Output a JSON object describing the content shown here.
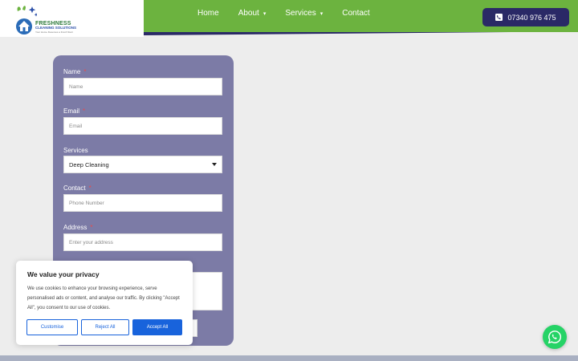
{
  "brand": {
    "title": "FRESHNESS",
    "subtitle": "CLEANING SOLUTIONS",
    "tagline": "Your Home Deserves a Fresh Start",
    "colors": {
      "green": "#6cb33f",
      "navy": "#2a2966",
      "accent_blue": "#1863dc"
    }
  },
  "nav": {
    "items": [
      {
        "label": "Home",
        "has_dropdown": false
      },
      {
        "label": "About",
        "has_dropdown": true
      },
      {
        "label": "Services",
        "has_dropdown": true
      },
      {
        "label": "Contact",
        "has_dropdown": false
      }
    ],
    "phone_label": "07340 976 475",
    "phone_icon": "phone-icon"
  },
  "form": {
    "name": {
      "label": "Name",
      "placeholder": "Name",
      "required": "*"
    },
    "email": {
      "label": "Email",
      "placeholder": "Email",
      "required": "*"
    },
    "services": {
      "label": "Services",
      "selected": "Deep Cleaning"
    },
    "contact": {
      "label": "Contact",
      "placeholder": "Phone Number",
      "required": "*"
    },
    "address": {
      "label": "Address",
      "placeholder": "Enter your address",
      "required": "*"
    }
  },
  "cookie": {
    "title": "We value your privacy",
    "text": "We use cookies to enhance your browsing experience, serve personalised ads or content, and analyse our traffic. By clicking \"Accept All\", you consent to our use of cookies.",
    "customise_label": "Customise",
    "reject_label": "Reject All",
    "accept_label": "Accept All"
  },
  "whatsapp": {
    "icon": "whatsapp-icon"
  }
}
